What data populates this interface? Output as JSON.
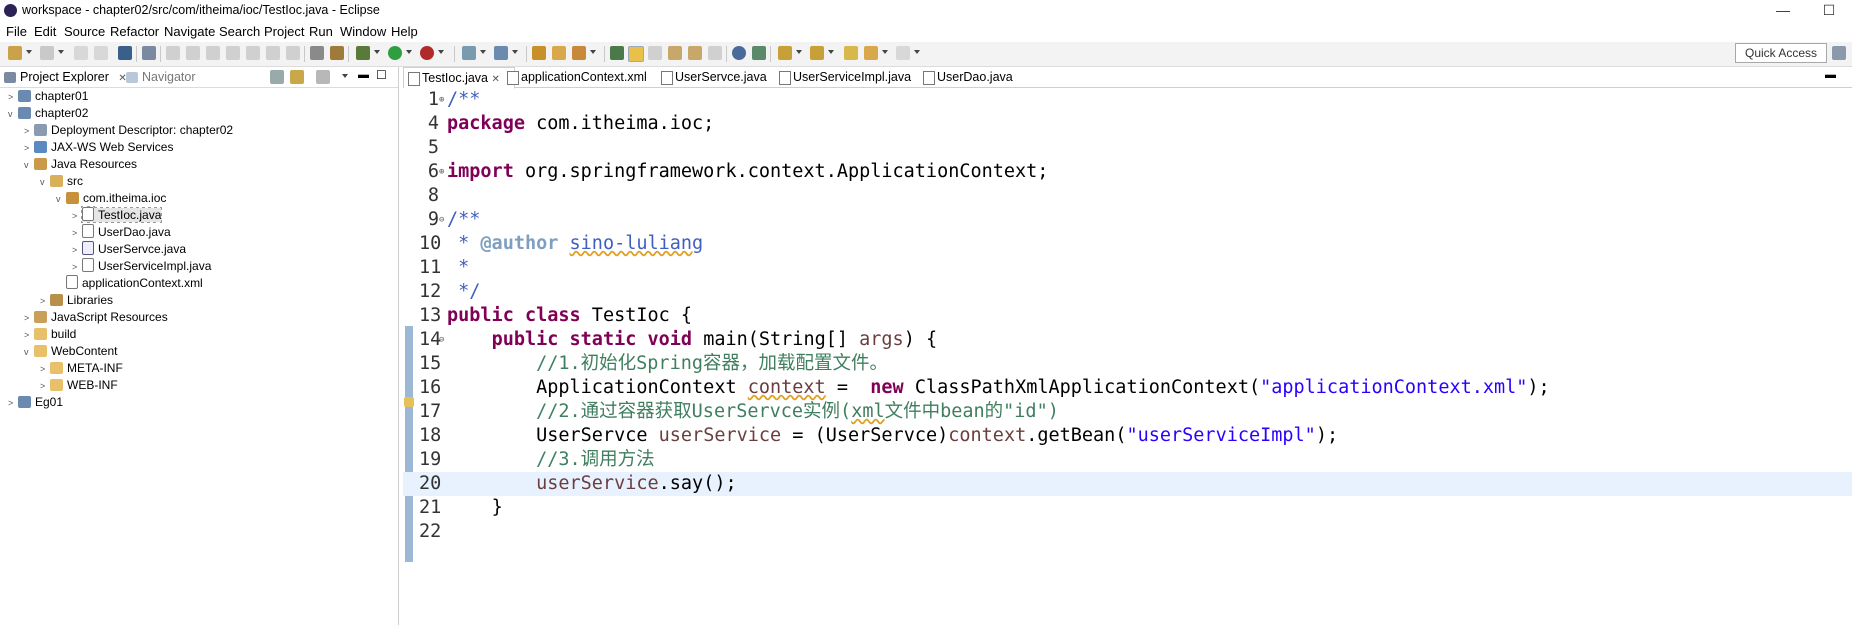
{
  "window": {
    "title": "workspace - chapter02/src/com/itheima/ioc/TestIoc.java - Eclipse",
    "controls": [
      "—",
      "☐"
    ]
  },
  "menu": [
    "File",
    "Edit",
    "Source",
    "Refactor",
    "Navigate",
    "Search",
    "Project",
    "Run",
    "Window",
    "Help"
  ],
  "toolbar": {
    "quick_access": "Quick Access"
  },
  "left_panel": {
    "tabs": [
      {
        "label": "Project Explorer",
        "close": "✕"
      },
      {
        "label": "Navigator"
      }
    ],
    "tree": [
      {
        "label": "chapter01",
        "twisty": ">",
        "icon": "project-icon"
      },
      {
        "label": "chapter02",
        "twisty": "v",
        "icon": "project-icon"
      },
      {
        "label": "Deployment Descriptor: chapter02",
        "twisty": ">",
        "icon": "deployment-descriptor-icon"
      },
      {
        "label": "JAX-WS Web Services",
        "twisty": ">",
        "icon": "web-services-icon"
      },
      {
        "label": "Java Resources",
        "twisty": "v",
        "icon": "java-resources-icon"
      },
      {
        "label": "src",
        "twisty": "v",
        "icon": "source-folder-icon"
      },
      {
        "label": "com.itheima.ioc",
        "twisty": "v",
        "icon": "package-icon"
      },
      {
        "label": "TestIoc.java",
        "twisty": ">",
        "icon": "java-file-icon"
      },
      {
        "label": "UserDao.java",
        "twisty": ">",
        "icon": "java-file-icon"
      },
      {
        "label": "UserServce.java",
        "twisty": ">",
        "icon": "java-interface-icon"
      },
      {
        "label": "UserServiceImpl.java",
        "twisty": ">",
        "icon": "java-file-icon"
      },
      {
        "label": "applicationContext.xml",
        "twisty": "",
        "icon": "xml-file-icon"
      },
      {
        "label": "Libraries",
        "twisty": ">",
        "icon": "libraries-icon"
      },
      {
        "label": "JavaScript Resources",
        "twisty": ">",
        "icon": "javascript-resources-icon"
      },
      {
        "label": "build",
        "twisty": ">",
        "icon": "folder-icon"
      },
      {
        "label": "WebContent",
        "twisty": "v",
        "icon": "folder-icon"
      },
      {
        "label": "META-INF",
        "twisty": ">",
        "icon": "folder-icon"
      },
      {
        "label": "WEB-INF",
        "twisty": ">",
        "icon": "folder-icon"
      },
      {
        "label": "Eg01",
        "twisty": ">",
        "icon": "project-icon"
      }
    ]
  },
  "editor": {
    "tabs": [
      {
        "label": "TestIoc.java",
        "close": "✕"
      },
      {
        "label": "applicationContext.xml"
      },
      {
        "label": "UserServce.java"
      },
      {
        "label": "UserServiceImpl.java"
      },
      {
        "label": "UserDao.java"
      }
    ],
    "line_numbers": [
      "1",
      "4",
      "5",
      "6",
      "8",
      "9",
      "10",
      "11",
      "12",
      "13",
      "14",
      "15",
      "16",
      "17",
      "18",
      "19",
      "20",
      "21",
      "22"
    ],
    "folds": {
      "1": "⊕",
      "6": "⊕",
      "9": "⊖",
      "14": "⊖"
    },
    "code": {
      "l1": "/**",
      "l4_kw": "package",
      "l4_rest": " com.itheima.ioc;",
      "l6_kw": "import",
      "l6_rest": " org.springframework.context.ApplicationContext;",
      "l9": "/**",
      "l10_pre": " * ",
      "l10_tag": "@author",
      "l10_sp": " ",
      "l10_name": "sino-luliang",
      "l11": " *",
      "l12": " */",
      "l13_kw1": "public",
      "l13_kw2": "class",
      "l13_rest": " TestIoc {",
      "l14_kw1": "public",
      "l14_kw2": "static",
      "l14_kw3": "void",
      "l14_rest1": " main(String[] ",
      "l14_var": "args",
      "l14_rest2": ") {",
      "l15": "//1.初始化Spring容器，加载配置文件。",
      "l16_type": "ApplicationContext ",
      "l16_var": "context",
      "l16_eq": " =  ",
      "l16_kw": "new",
      "l16_rest": " ClassPathXmlApplicationContext(",
      "l16_str": "\"applicationContext.xml\"",
      "l16_end": ");",
      "l17_a": "//2.通过容器获取UserServce实例(",
      "l17_xml": "xml",
      "l17_b": "文件中bean的\"id\")",
      "l18_type": "UserServce ",
      "l18_var": "userService",
      "l18_mid": " = (UserServce)",
      "l18_var2": "context",
      "l18_call": ".getBean(",
      "l18_str": "\"userServiceImpl\"",
      "l18_end": ");",
      "l19": "//3.调用方法",
      "l20_var": "userService",
      "l20_rest": ".say();",
      "l21": "}"
    }
  },
  "colors": {
    "keyword": "#7f0055",
    "comment": "#3f7f5f",
    "string": "#2a00ff",
    "javadoc": "#3f5fbf",
    "current_line": "#e8f2fe"
  }
}
